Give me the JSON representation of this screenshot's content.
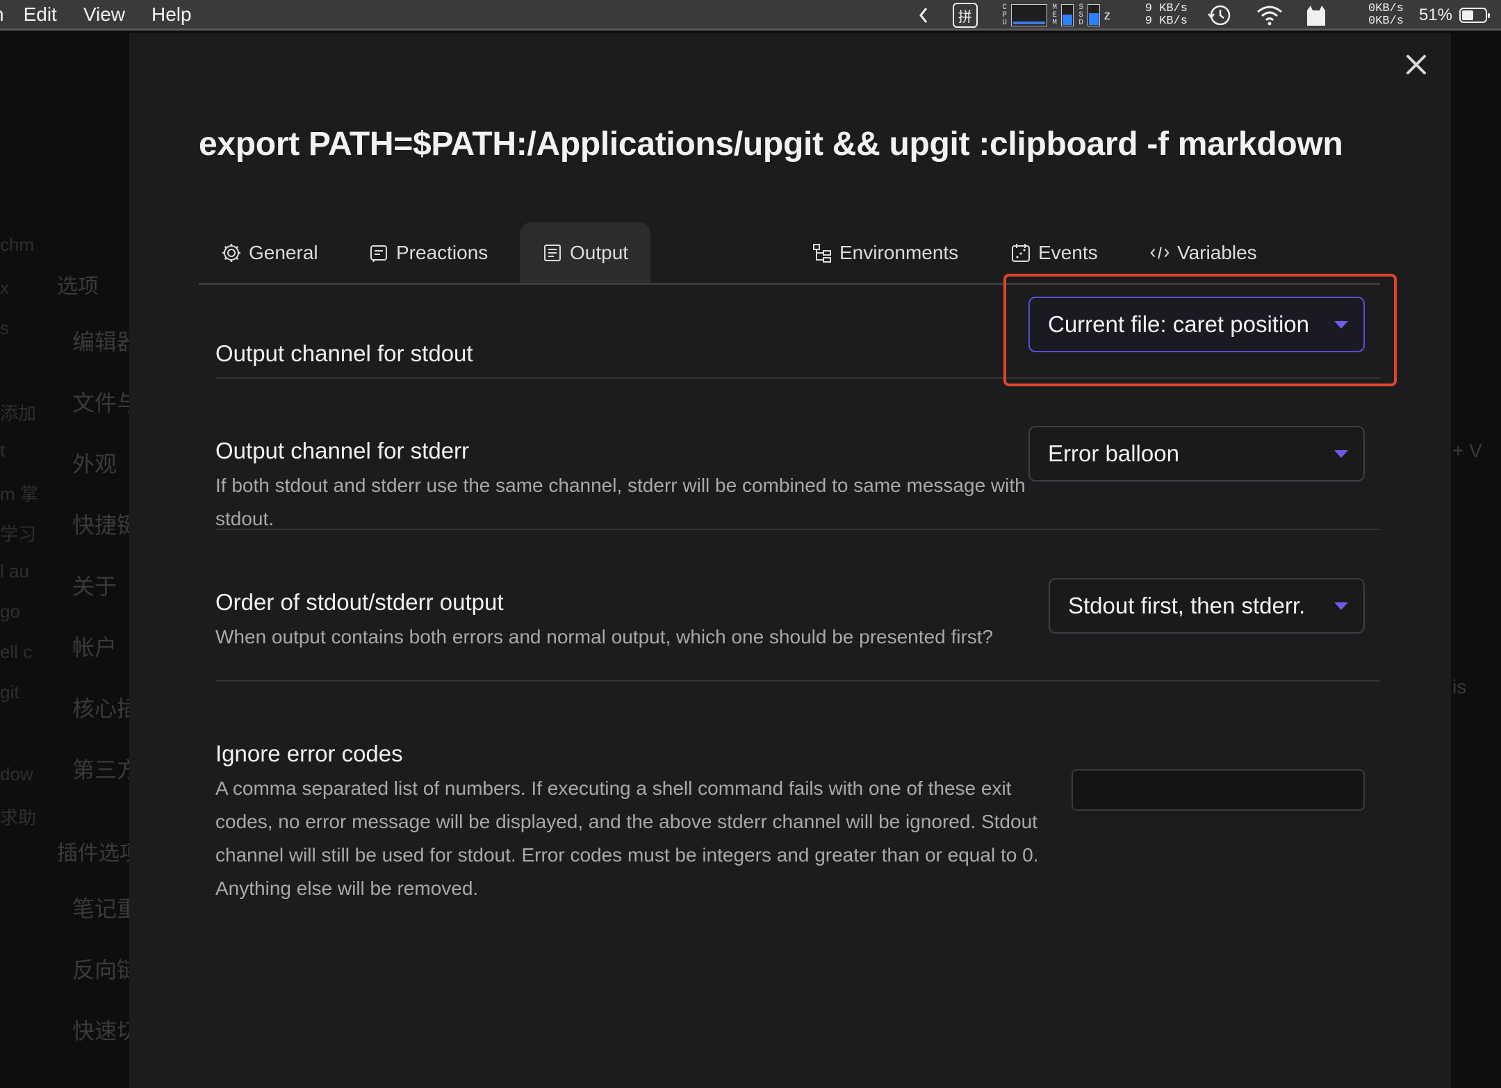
{
  "menubar": {
    "apple_fragment": "n",
    "menus": [
      "Edit",
      "View",
      "Help"
    ],
    "status": {
      "input_method": "拼",
      "cpu_label": "CPU",
      "mem_label": "MEM",
      "ssd_label": "SSD",
      "net_up": "9 KB/s",
      "net_down": "9 KB/s",
      "disk_read": "0KB/s",
      "disk_write": "0KB/s",
      "battery_percent": "51%",
      "battery_level": 0.51,
      "mem_usage": 0.55,
      "ssd_usage": 0.6
    }
  },
  "background": {
    "sidebar_header_1": "选项",
    "sidebar_items": [
      "编辑器",
      "文件与",
      "外观",
      "快捷键",
      "关于",
      "帐户",
      "核心插",
      "第三方"
    ],
    "sidebar_header_2": "插件选项",
    "sidebar_items_2": [
      "笔记重",
      "反向链",
      "快速切"
    ],
    "left_fragments": [
      "chm",
      "x",
      "s",
      "添加",
      "t",
      "m 掌",
      "学习",
      "l au",
      "go",
      "ell c",
      "git",
      "dow",
      "求助"
    ],
    "right_fragments": [
      "+ V",
      "is"
    ]
  },
  "modal": {
    "title": "export PATH=$PATH:/Applications/upgit && upgit :clipboard -f markdown",
    "tabs": [
      {
        "label": "General",
        "icon": "gear-icon"
      },
      {
        "label": "Preactions",
        "icon": "preactions-icon"
      },
      {
        "label": "Output",
        "icon": "output-icon",
        "active": true
      },
      {
        "label": "Environments",
        "icon": "environments-icon"
      },
      {
        "label": "Events",
        "icon": "events-icon"
      },
      {
        "label": "Variables",
        "icon": "code-icon"
      }
    ],
    "settings": {
      "stdout": {
        "title": "Output channel for stdout",
        "value": "Current file: caret position"
      },
      "stderr": {
        "title": "Output channel for stderr",
        "description": "If both stdout and stderr use the same channel, stderr will be combined to same message with stdout.",
        "value": "Error balloon"
      },
      "order": {
        "title": "Order of stdout/stderr output",
        "description": "When output contains both errors and normal output, which one should be presented first?",
        "value": "Stdout first, then stderr."
      },
      "ignore_codes": {
        "title": "Ignore error codes",
        "description": "A comma separated list of numbers. If executing a shell command fails with one of these exit codes, no error message will be displayed, and the above stderr channel will be ignored. Stdout channel will still be used for stdout. Error codes must be integers and greater than or equal to 0. Anything else will be removed.",
        "value": ""
      }
    },
    "highlight_color": "#e0442d",
    "accent_color": "#6c5ce7"
  }
}
